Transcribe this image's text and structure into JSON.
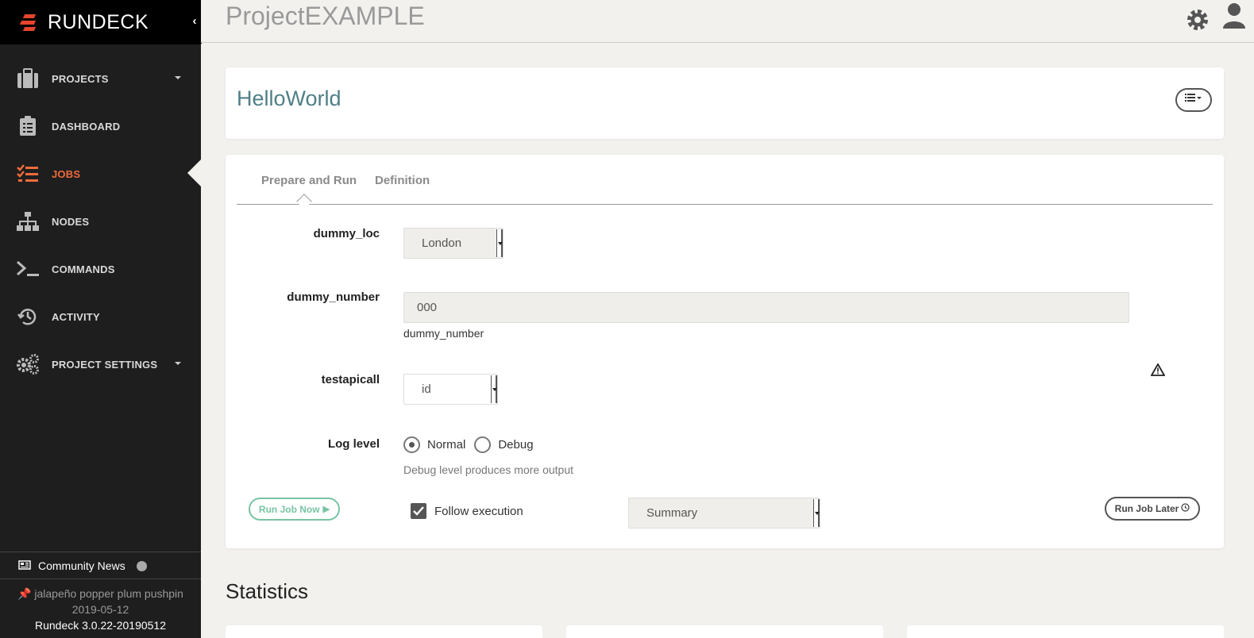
{
  "brand": {
    "name": "RUNDECK"
  },
  "nav": [
    {
      "label": "PROJECTS",
      "icon": "briefcase-icon",
      "has_caret": true
    },
    {
      "label": "DASHBOARD",
      "icon": "clipboard-icon",
      "has_caret": false
    },
    {
      "label": "JOBS",
      "icon": "tasks-icon",
      "has_caret": false,
      "active": true
    },
    {
      "label": "NODES",
      "icon": "sitemap-icon",
      "has_caret": false
    },
    {
      "label": "COMMANDS",
      "icon": "terminal-icon",
      "has_caret": false
    },
    {
      "label": "ACTIVITY",
      "icon": "history-icon",
      "has_caret": false
    },
    {
      "label": "PROJECT SETTINGS",
      "icon": "gears-icon",
      "has_caret": true
    }
  ],
  "footer": {
    "news_label": "Community News",
    "codename": "jalapeño popper plum pushpin",
    "date": "2019-05-12",
    "version": "Rundeck 3.0.22-20190512"
  },
  "header": {
    "project": "ProjectEXAMPLE"
  },
  "job": {
    "name": "HelloWorld"
  },
  "tabs": {
    "prepare": "Prepare and Run",
    "definition": "Definition"
  },
  "options": {
    "dummy_loc": {
      "label": "dummy_loc",
      "value": "London"
    },
    "dummy_number": {
      "label": "dummy_number",
      "value": "000",
      "help": "dummy_number"
    },
    "testapicall": {
      "label": "testapicall",
      "value": "id"
    }
  },
  "log_level": {
    "label": "Log level",
    "options": [
      "Normal",
      "Debug"
    ],
    "selected": "Normal",
    "help": "Debug level produces more output"
  },
  "actions": {
    "run_now": "Run Job Now",
    "follow_label": "Follow execution",
    "follow_checked": true,
    "follow_mode": "Summary",
    "run_later": "Run Job Later"
  },
  "stats": {
    "title": "Statistics"
  },
  "colors": {
    "accent": "#ef6b3b",
    "brand_red": "#e4452c",
    "run_green": "#78c3a3",
    "job_name": "#4f7f86"
  }
}
